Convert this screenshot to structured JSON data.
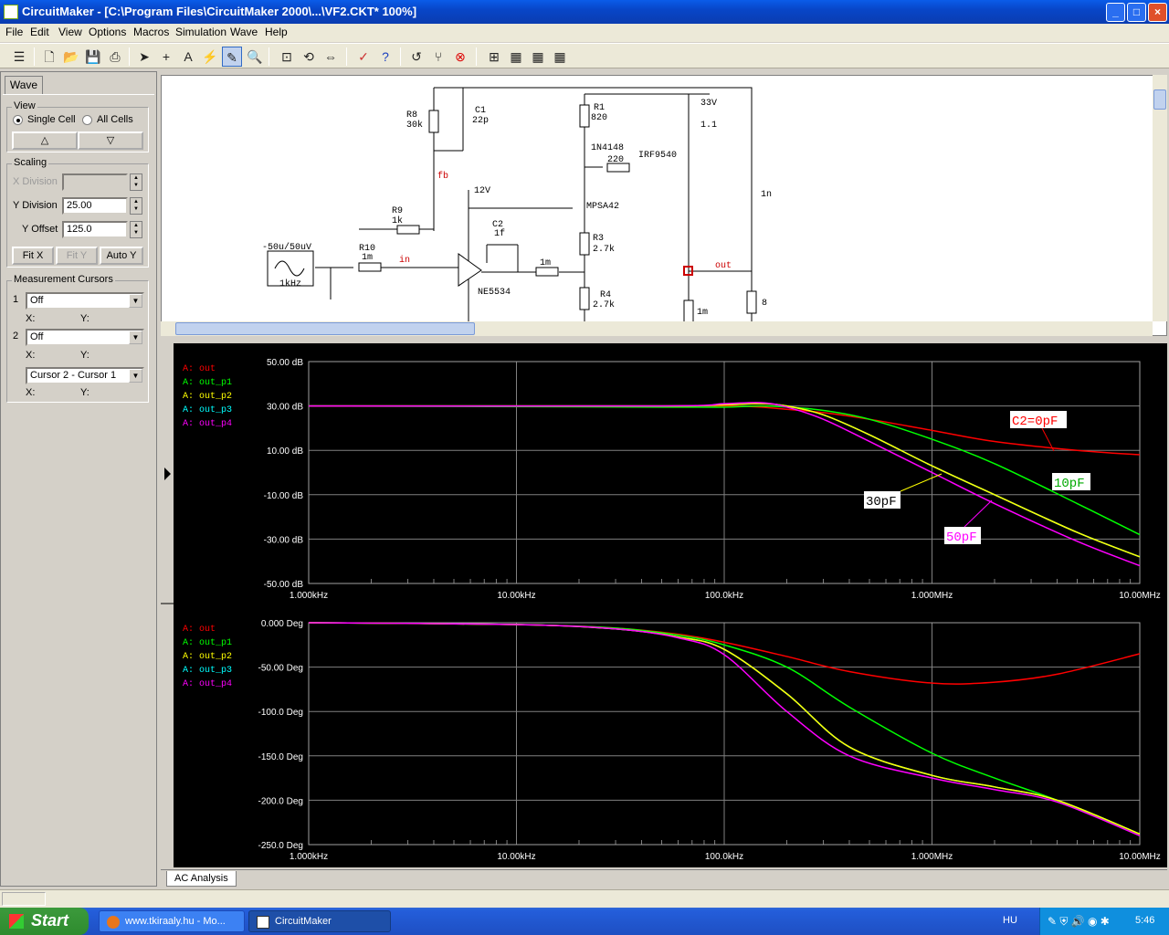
{
  "window": {
    "title": "CircuitMaker - [C:\\Program Files\\CircuitMaker 2000\\...\\VF2.CKT* 100%]"
  },
  "window_buttons": {
    "min": "_",
    "max": "□",
    "close": "×"
  },
  "menu": [
    "File",
    "Edit",
    "View",
    "Options",
    "Macros",
    "Simulation",
    "Wave",
    "Help"
  ],
  "toolbar_icons": [
    "toggle-icon",
    "new-icon",
    "open-icon",
    "save-icon",
    "print-icon",
    "arrow-icon",
    "wire-icon",
    "text-icon",
    "probe-icon",
    "probe-tool-icon",
    "zoom-icon",
    "zoom-fit-icon",
    "rotate-icon",
    "mirror-icon",
    "check-icon",
    "help-icon",
    "reset-icon",
    "step-icon",
    "stop-icon",
    "analysis-icon-1",
    "analysis-icon-2",
    "analysis-icon-3",
    "analysis-icon-4"
  ],
  "panel": {
    "tab": "Wave",
    "view": {
      "title": "View",
      "single": "Single Cell",
      "all": "All Cells",
      "up": "△",
      "down": "▽"
    },
    "scaling": {
      "title": "Scaling",
      "xdiv_label": "X Division",
      "xdiv_value": "",
      "ydiv_label": "Y Division",
      "ydiv_value": "25.00",
      "yoff_label": "Y Offset",
      "yoff_value": "125.0",
      "fitx": "Fit X",
      "fity": "Fit Y",
      "autoy": "Auto Y"
    },
    "cursors": {
      "title": "Measurement Cursors",
      "c1_num": "1",
      "c1": "Off",
      "c2_num": "2",
      "c2": "Off",
      "x": "X:",
      "y": "Y:",
      "diff": "Cursor 2 - Cursor 1"
    }
  },
  "schematic": {
    "labels": [
      "R8",
      "30k",
      "C1",
      "22p",
      "R1",
      "820",
      "1N4148",
      "220",
      "IRF9540",
      "33V",
      "1.1",
      "fb",
      "12V",
      "MPSA42",
      "1n",
      "R9",
      "1k",
      "C2",
      "1f",
      "R3",
      "2.7k",
      "-50u/50uV",
      "R10",
      "1m",
      "in",
      "1kHz",
      "1m",
      "out",
      "NE5534",
      "R4",
      "2.7k",
      "1m",
      "8"
    ]
  },
  "plots": {
    "colors": {
      "out": "#ff0000",
      "out_p1": "#00ff00",
      "out_p2": "#ffff00",
      "out_p3": "#00ffff",
      "out_p4": "#ff00ff"
    },
    "legend": [
      "A: out",
      "A: out_p1",
      "A: out_p2",
      "A: out_p3",
      "A: out_p4"
    ],
    "mag_annotations": {
      "c0": "C2=0pF",
      "c10": "10pF",
      "c30": "30pF",
      "c50": "50pF"
    }
  },
  "chart_data": [
    {
      "type": "line",
      "title": "",
      "xscale": "log",
      "xlim": [
        1000,
        10000000
      ],
      "ylim": [
        -50,
        50
      ],
      "xticks": [
        "1.000kHz",
        "10.00kHz",
        "100.0kHz",
        "1.000MHz",
        "10.00MHz"
      ],
      "yticks": [
        "50.00 dB",
        "30.00 dB",
        "10.00 dB",
        "-10.00 dB",
        "-30.00 dB",
        "-50.00 dB"
      ],
      "series": [
        {
          "name": "A: out",
          "x": [
            1000,
            50000,
            100000,
            150000,
            200000,
            300000,
            500000,
            1000000,
            2000000,
            5000000,
            10000000
          ],
          "y": [
            30,
            30,
            30,
            29.5,
            28.5,
            27,
            24,
            19,
            14,
            10,
            8
          ]
        },
        {
          "name": "A: out_p1",
          "x": [
            1000,
            50000,
            100000,
            150000,
            200000,
            300000,
            500000,
            1000000,
            2000000,
            5000000,
            10000000
          ],
          "y": [
            30,
            29.5,
            29.5,
            30,
            29.5,
            28,
            24,
            15,
            4,
            -14,
            -28
          ]
        },
        {
          "name": "A: out_p2",
          "x": [
            1000,
            50000,
            100000,
            150000,
            200000,
            300000,
            500000,
            1000000,
            2000000,
            5000000,
            10000000
          ],
          "y": [
            30,
            30,
            30.5,
            31,
            30,
            26,
            17,
            3,
            -10,
            -27,
            -38
          ]
        },
        {
          "name": "A: out_p3",
          "x": [
            1000,
            50000,
            100000,
            150000,
            200000,
            300000,
            500000,
            1000000,
            2000000,
            5000000,
            10000000
          ],
          "y": [
            30,
            30,
            30.5,
            31,
            30,
            26,
            17,
            3,
            -10,
            -27,
            -38
          ]
        },
        {
          "name": "A: out_p4",
          "x": [
            1000,
            50000,
            100000,
            150000,
            200000,
            300000,
            500000,
            1000000,
            2000000,
            5000000,
            10000000
          ],
          "y": [
            30,
            30,
            31,
            31.5,
            29.5,
            24,
            14,
            0,
            -14,
            -31,
            -42
          ]
        }
      ]
    },
    {
      "type": "line",
      "title": "",
      "xscale": "log",
      "xlim": [
        1000,
        10000000
      ],
      "ylim": [
        -250,
        0
      ],
      "xticks": [
        "1.000kHz",
        "10.00kHz",
        "100.0kHz",
        "1.000MHz",
        "10.00MHz"
      ],
      "yticks": [
        "0.000 Deg",
        "-50.00 Deg",
        "-100.0 Deg",
        "-150.0 Deg",
        "-200.0 Deg",
        "-250.0 Deg"
      ],
      "series": [
        {
          "name": "A: out",
          "x": [
            1000,
            10000,
            30000,
            60000,
            100000,
            200000,
            400000,
            1000000,
            2000000,
            4000000,
            10000000
          ],
          "y": [
            0,
            -2,
            -6,
            -13,
            -22,
            -38,
            -55,
            -68,
            -67,
            -58,
            -35
          ]
        },
        {
          "name": "A: out_p1",
          "x": [
            1000,
            10000,
            30000,
            60000,
            100000,
            200000,
            400000,
            1000000,
            2000000,
            4000000,
            10000000
          ],
          "y": [
            0,
            -2,
            -6,
            -14,
            -25,
            -50,
            -95,
            -147,
            -175,
            -200,
            -238
          ]
        },
        {
          "name": "A: out_p2",
          "x": [
            1000,
            10000,
            30000,
            60000,
            100000,
            200000,
            400000,
            1000000,
            2000000,
            4000000,
            10000000
          ],
          "y": [
            0,
            -2,
            -7,
            -16,
            -30,
            -80,
            -140,
            -172,
            -185,
            -200,
            -238
          ]
        },
        {
          "name": "A: out_p3",
          "x": [
            1000,
            10000,
            30000,
            60000,
            100000,
            200000,
            400000,
            1000000,
            2000000,
            4000000,
            10000000
          ],
          "y": [
            0,
            -2,
            -7,
            -16,
            -30,
            -80,
            -140,
            -172,
            -185,
            -200,
            -238
          ]
        },
        {
          "name": "A: out_p4",
          "x": [
            1000,
            10000,
            30000,
            60000,
            100000,
            200000,
            400000,
            1000000,
            2000000,
            4000000,
            10000000
          ],
          "y": [
            0,
            -2,
            -7,
            -17,
            -36,
            -100,
            -150,
            -175,
            -188,
            -202,
            -240
          ]
        }
      ]
    }
  ],
  "bottom_tab": "AC Analysis",
  "taskbar": {
    "start": "Start",
    "task1": "www.tkiraaly.hu - Mo...",
    "task2": "CircuitMaker",
    "lang": "HU",
    "clock": "5:46"
  }
}
